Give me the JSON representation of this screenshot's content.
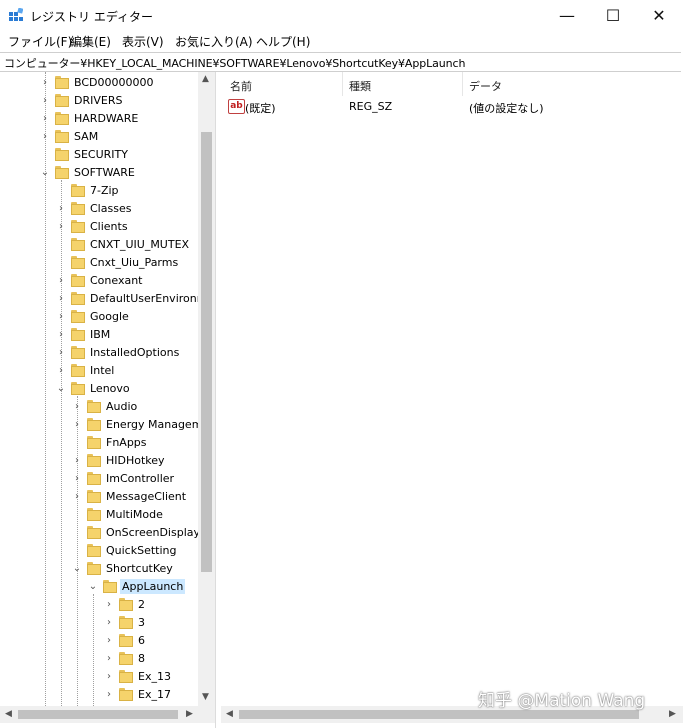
{
  "window": {
    "title": "レジストリ エディター",
    "minimize_glyph": "—",
    "maximize_glyph": "☐",
    "close_glyph": "✕"
  },
  "menu": [
    "ファイル(F)",
    "編集(E)",
    "表示(V)",
    "お気に入り(A)",
    "ヘルプ(H)"
  ],
  "address": "コンピューター¥HKEY_LOCAL_MACHINE¥SOFTWARE¥Lenovo¥ShortcutKey¥AppLaunch",
  "tree": [
    {
      "label": "BCD00000000",
      "twisty": "›"
    },
    {
      "label": "DRIVERS",
      "twisty": "›"
    },
    {
      "label": "HARDWARE",
      "twisty": "›"
    },
    {
      "label": "SAM",
      "twisty": "›"
    },
    {
      "label": "SECURITY",
      "twisty": ""
    },
    {
      "label": "SOFTWARE",
      "twisty": "⌄"
    },
    {
      "label": "7-Zip",
      "twisty": ""
    },
    {
      "label": "Classes",
      "twisty": "›"
    },
    {
      "label": "Clients",
      "twisty": "›"
    },
    {
      "label": "CNXT_UIU_MUTEX",
      "twisty": ""
    },
    {
      "label": "Cnxt_Uiu_Parms",
      "twisty": ""
    },
    {
      "label": "Conexant",
      "twisty": "›"
    },
    {
      "label": "DefaultUserEnvironn",
      "twisty": "›"
    },
    {
      "label": "Google",
      "twisty": "›"
    },
    {
      "label": "IBM",
      "twisty": "›"
    },
    {
      "label": "InstalledOptions",
      "twisty": "›"
    },
    {
      "label": "Intel",
      "twisty": "›"
    },
    {
      "label": "Lenovo",
      "twisty": "⌄"
    },
    {
      "label": "Audio",
      "twisty": "›"
    },
    {
      "label": "Energy Managem",
      "twisty": "›"
    },
    {
      "label": "FnApps",
      "twisty": ""
    },
    {
      "label": "HIDHotkey",
      "twisty": "›"
    },
    {
      "label": "ImController",
      "twisty": "›"
    },
    {
      "label": "MessageClient",
      "twisty": "›"
    },
    {
      "label": "MultiMode",
      "twisty": ""
    },
    {
      "label": "OnScreenDisplay",
      "twisty": ""
    },
    {
      "label": "QuickSetting",
      "twisty": ""
    },
    {
      "label": "ShortcutKey",
      "twisty": "⌄"
    },
    {
      "label": "AppLaunch",
      "twisty": "⌄"
    },
    {
      "label": "2",
      "twisty": "›"
    },
    {
      "label": "3",
      "twisty": "›"
    },
    {
      "label": "6",
      "twisty": "›"
    },
    {
      "label": "8",
      "twisty": "›"
    },
    {
      "label": "Ex_13",
      "twisty": "›"
    },
    {
      "label": "Ex_17",
      "twisty": "›"
    }
  ],
  "list": {
    "columns": [
      "名前",
      "種類",
      "データ"
    ],
    "rows": [
      {
        "name": "(既定)",
        "type": "REG_SZ",
        "data": "(値の設定なし)",
        "icon": "ab"
      }
    ]
  },
  "watermark": "知乎 @Mation Wang"
}
